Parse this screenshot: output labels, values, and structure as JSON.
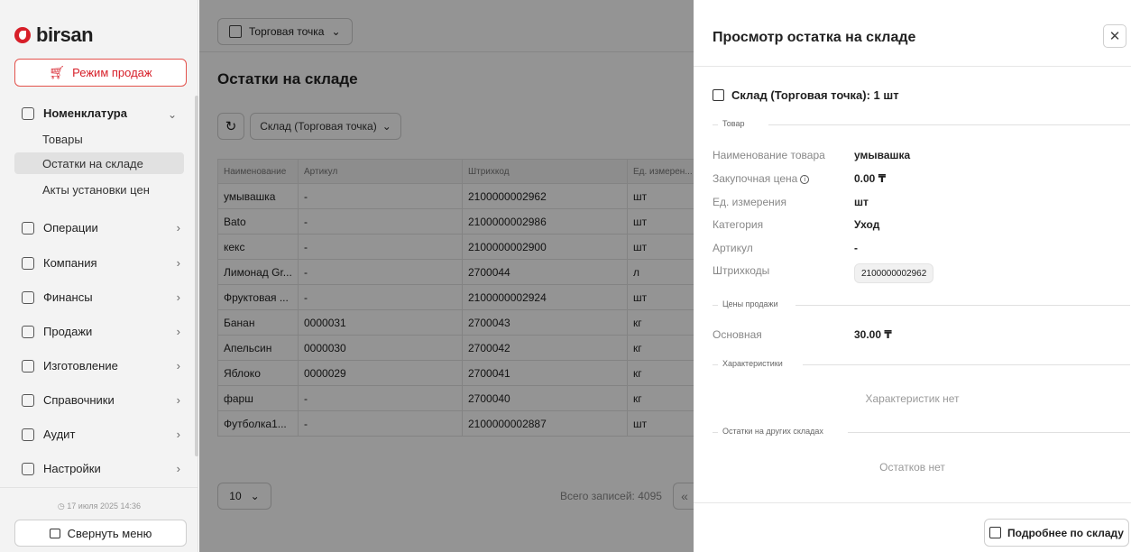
{
  "app": {
    "logo_text": "birsan",
    "brand_color": "#d71f29"
  },
  "sidebar": {
    "sales_mode_label": "Режим продаж",
    "groups": [
      {
        "label": "Номенклатура",
        "icon": "box-icon",
        "expanded": true,
        "items": [
          {
            "label": "Товары",
            "active": false
          },
          {
            "label": "Остатки на складе",
            "active": true
          },
          {
            "label": "Акты установки цен",
            "active": false
          }
        ]
      }
    ],
    "nav": [
      {
        "label": "Операции",
        "icon": "copy-icon"
      },
      {
        "label": "Компания",
        "icon": "briefcase-icon"
      },
      {
        "label": "Финансы",
        "icon": "wallet-icon"
      },
      {
        "label": "Продажи",
        "icon": "bag-icon"
      },
      {
        "label": "Изготовление",
        "icon": "factory-icon"
      },
      {
        "label": "Справочники",
        "icon": "books-icon"
      },
      {
        "label": "Аудит",
        "icon": "layers-icon"
      },
      {
        "label": "Настройки",
        "icon": "gear-icon"
      }
    ],
    "datetime": "17 июля 2025 14:36",
    "collapse_label": "Свернуть меню"
  },
  "main": {
    "store_select": "Торговая точка",
    "title": "Остатки на складе",
    "warehouse_filter": "Склад (Торговая точка)",
    "table": {
      "columns": [
        "Наименование",
        "Артикул",
        "Штрихкод",
        "Ед. измерен..."
      ],
      "rows": [
        [
          "умывашка",
          "-",
          "2100000002962",
          "шт"
        ],
        [
          "Bato",
          "-",
          "2100000002986",
          "шт"
        ],
        [
          "кекс",
          "-",
          "2100000002900",
          "шт"
        ],
        [
          "Лимонад Gr...",
          "-",
          "2700044",
          "л"
        ],
        [
          "Фруктовая ...",
          "-",
          "2100000002924",
          "шт"
        ],
        [
          "Банан",
          "0000031",
          "2700043",
          "кг"
        ],
        [
          "Апельсин",
          "0000030",
          "2700042",
          "кг"
        ],
        [
          "Яблоко",
          "0000029",
          "2700041",
          "кг"
        ],
        [
          "фарш",
          "-",
          "2700040",
          "кг"
        ],
        [
          "Футболка1...",
          "-",
          "2100000002887",
          "шт"
        ]
      ]
    },
    "page_size": "10",
    "total_label": "Всего записей: 4095"
  },
  "drawer": {
    "title": "Просмотр остатка на складе",
    "stock_heading": "Склад (Торговая точка): 1 шт",
    "product_section": "Товар",
    "fields": [
      {
        "label": "Наименование товара",
        "value": "умывашка"
      },
      {
        "label": "Закупочная цена",
        "value": "0.00 ₸"
      },
      {
        "label": "Ед. измерения",
        "value": "шт"
      },
      {
        "label": "Категория",
        "value": "Уход"
      },
      {
        "label": "Артикул",
        "value": "-"
      },
      {
        "label": "Штрихкоды",
        "value": "2100000002962"
      }
    ],
    "prices_section": "Цены продажи",
    "price_label": "Основная",
    "price_value": "30.00 ₸",
    "characteristics_section": "Характеристики",
    "characteristics_empty": "Характеристик нет",
    "other_stock_section": "Остатки на других складах",
    "other_stock_empty": "Остатков нет",
    "detail_button": "Подробнее по складу"
  }
}
